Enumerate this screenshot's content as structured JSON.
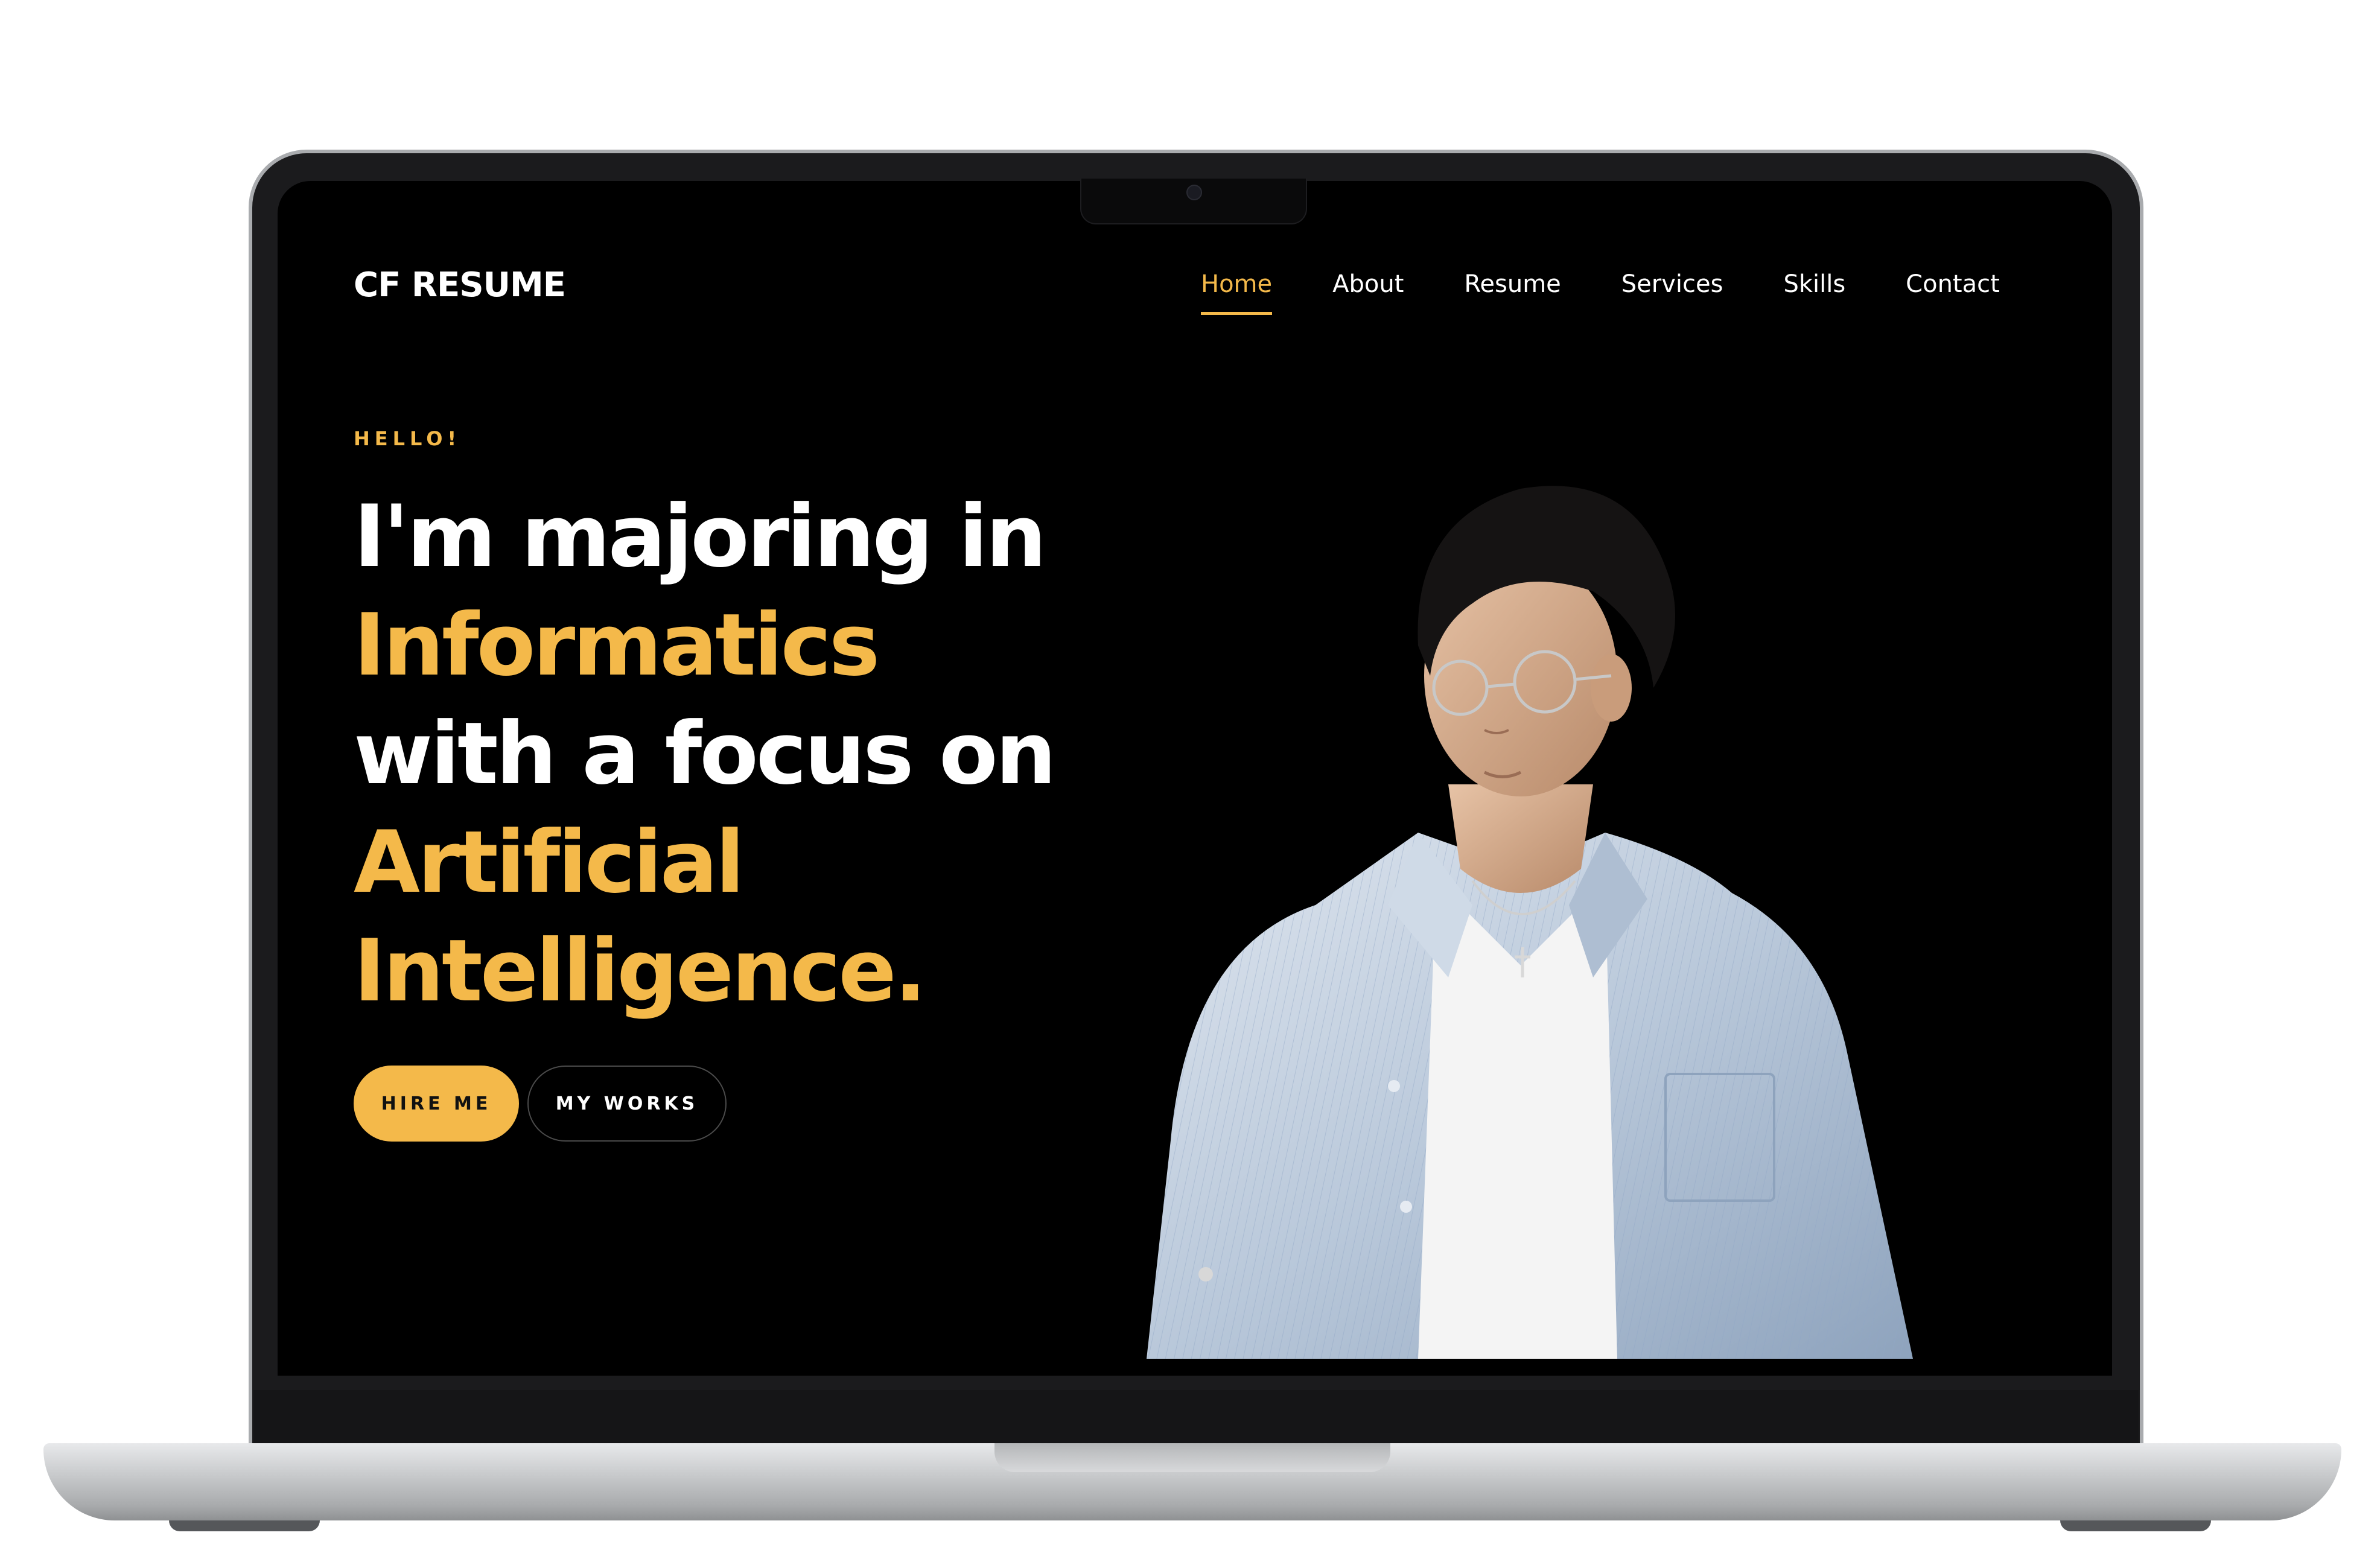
{
  "header": {
    "logo": "CF RESUME",
    "nav": [
      {
        "label": "Home",
        "active": true
      },
      {
        "label": "About",
        "active": false
      },
      {
        "label": "Resume",
        "active": false
      },
      {
        "label": "Services",
        "active": false
      },
      {
        "label": "Skills",
        "active": false
      },
      {
        "label": "Contact",
        "active": false
      }
    ]
  },
  "hero": {
    "eyebrow": "HELLO!",
    "headline": [
      {
        "text": "I'm majoring in",
        "accent": false
      },
      {
        "text": "Informatics",
        "accent": true
      },
      {
        "text": "with a focus on",
        "accent": false
      },
      {
        "text": "Artificial",
        "accent": true
      },
      {
        "text": "Intelligence.",
        "accent": true
      }
    ],
    "buttons": {
      "hire": "HIRE ME",
      "works": "MY WORKS"
    },
    "portrait": "portrait-photo"
  },
  "colors": {
    "accent": "#f4b94a",
    "background": "#000000",
    "text": "#ffffff"
  }
}
